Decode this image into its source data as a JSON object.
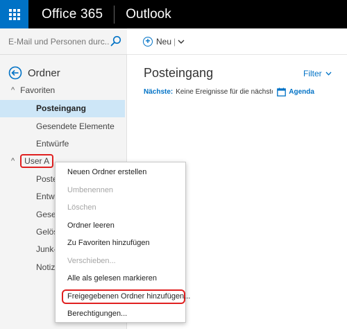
{
  "suite": {
    "brand": "Office 365",
    "app": "Outlook"
  },
  "search": {
    "placeholder": "E-Mail und Personen durc..."
  },
  "folders": {
    "title": "Ordner",
    "favorites_label": "Favoriten",
    "favorites": [
      {
        "label": "Posteingang",
        "selected": true
      },
      {
        "label": "Gesendete Elemente",
        "selected": false
      },
      {
        "label": "Entwürfe",
        "selected": false
      }
    ],
    "account_label": "User A",
    "account_folders": [
      "Poste",
      "Entwü",
      "Gesen",
      "Gelös",
      "Junk-",
      "Notiz"
    ]
  },
  "command_bar": {
    "new_label": "Neu",
    "separator": "|"
  },
  "inbox": {
    "title": "Posteingang",
    "filter_label": "Filter",
    "next_label": "Nächste:",
    "next_text": "Keine Ereignisse für die nächsten zwei",
    "agenda_label": "Agenda"
  },
  "context_menu": {
    "items": [
      {
        "label": "Neuen Ordner erstellen",
        "enabled": true
      },
      {
        "label": "Umbenennen",
        "enabled": false
      },
      {
        "label": "Löschen",
        "enabled": false
      },
      {
        "label": "Ordner leeren",
        "enabled": true
      },
      {
        "label": "Zu Favoriten hinzufügen",
        "enabled": true
      },
      {
        "label": "Verschieben...",
        "enabled": false
      },
      {
        "label": "Alle als gelesen markieren",
        "enabled": true
      },
      {
        "label": "Freigegebenen Ordner hinzufügen...",
        "enabled": true
      },
      {
        "label": "Berechtigungen...",
        "enabled": true
      }
    ]
  },
  "colors": {
    "accent": "#0072c6",
    "selection": "#cde6f7",
    "highlight_ring": "#e02020"
  }
}
